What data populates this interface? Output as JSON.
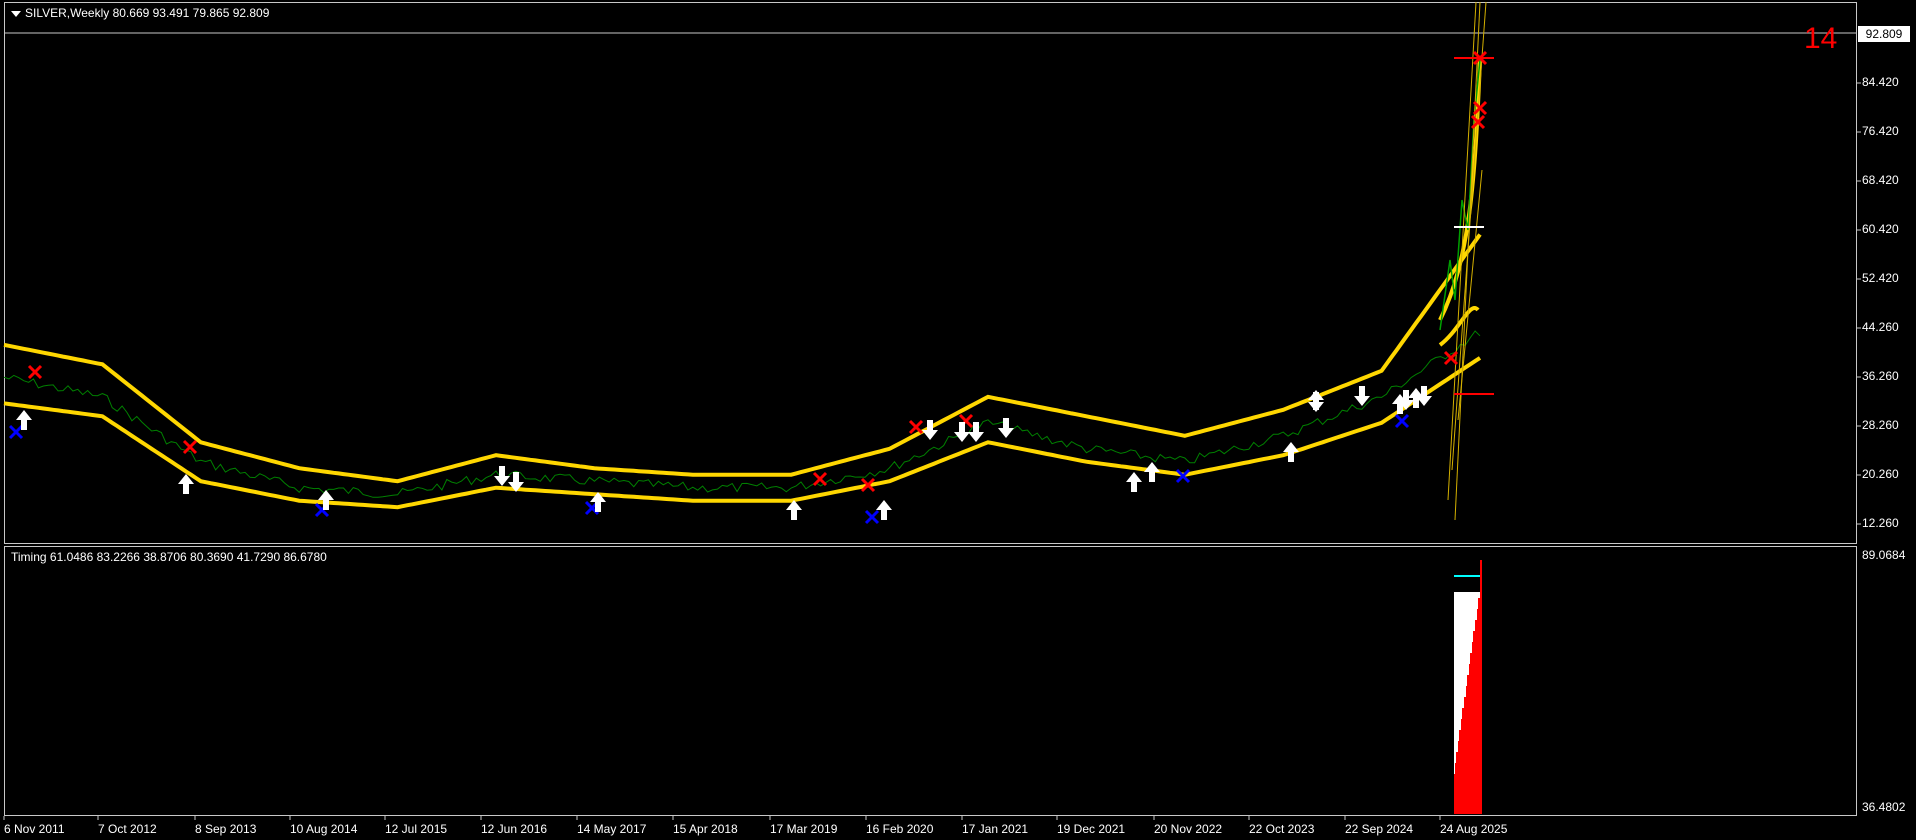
{
  "main_pane": {
    "title": "SILVER,Weekly  80.669 93.491 79.865 92.809",
    "current_price": "92.809",
    "corner_number": "14",
    "price_labels": [
      "84.420",
      "76.420",
      "68.420",
      "60.420",
      "52.420",
      "44.260",
      "36.260",
      "28.260",
      "20.260",
      "12.260"
    ]
  },
  "sub_pane": {
    "title": "Timing 61.0486 83.2266 38.8706 80.3690 41.7290 86.6780",
    "price_labels": [
      "89.0684",
      "36.4802"
    ]
  },
  "x_labels": [
    "6 Nov 2011",
    "7 Oct 2012",
    "8 Sep 2013",
    "10 Aug 2014",
    "12 Jul 2015",
    "12 Jun 2016",
    "14 May 2017",
    "15 Apr 2018",
    "17 Mar 2019",
    "16 Feb 2020",
    "17 Jan 2021",
    "19 Dec 2021",
    "20 Nov 2022",
    "22 Oct 2023",
    "22 Sep 2024",
    "24 Aug 2025"
  ],
  "chart_data": {
    "type": "line",
    "ylim": [
      12.26,
      94.5
    ],
    "x": [
      "6 Nov 2011",
      "7 Oct 2012",
      "8 Sep 2013",
      "10 Aug 2014",
      "12 Jul 2015",
      "12 Jun 2016",
      "14 May 2017",
      "15 Apr 2018",
      "17 Mar 2019",
      "16 Feb 2020",
      "17 Jan 2021",
      "19 Dec 2021",
      "20 Nov 2022",
      "22 Oct 2023",
      "22 Sep 2024",
      "24 Aug 2025"
    ],
    "series": [
      {
        "values": [
          33,
          30,
          20,
          16,
          15,
          18,
          17,
          16,
          16,
          19,
          26,
          22,
          20,
          24,
          30,
          40
        ],
        "color": "#008000"
      },
      {
        "values": [
          38,
          35,
          23,
          19,
          17,
          21,
          19,
          18,
          18,
          22,
          30,
          27,
          24,
          28,
          34,
          55
        ],
        "color": "#ffd700"
      },
      {
        "values": [
          29,
          27,
          17,
          14,
          13,
          16,
          15,
          14,
          14,
          17,
          23,
          20,
          18,
          21,
          26,
          36
        ],
        "color": "#ffd700"
      }
    ],
    "colors": {
      "background": "#000000",
      "grid_border": "#c8c8c8",
      "up_arrow": "#ffffff",
      "sell_mark": "#ff0000",
      "buy_mark": "#0000ff",
      "timing_bar": "#ff0000",
      "timing_level": "#00ffff"
    }
  }
}
